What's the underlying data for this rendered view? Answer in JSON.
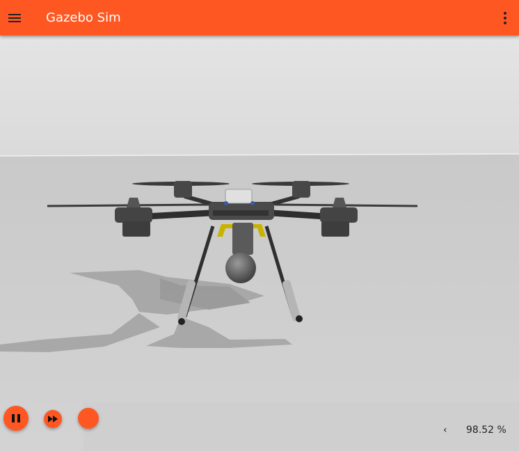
{
  "app": {
    "title": "Gazebo Sim"
  },
  "icons": {
    "menu": "hamburger-menu-icon",
    "more": "more-vert-icon",
    "play": "pause-icon",
    "step": "fast-forward-icon",
    "collapse": "chevron-left-icon"
  },
  "colors": {
    "accent": "#ff5722",
    "sky": "#dedede",
    "ground": "#cfcfcf"
  },
  "status": {
    "collapse_glyph": "‹",
    "rtf": "98.52 %"
  }
}
